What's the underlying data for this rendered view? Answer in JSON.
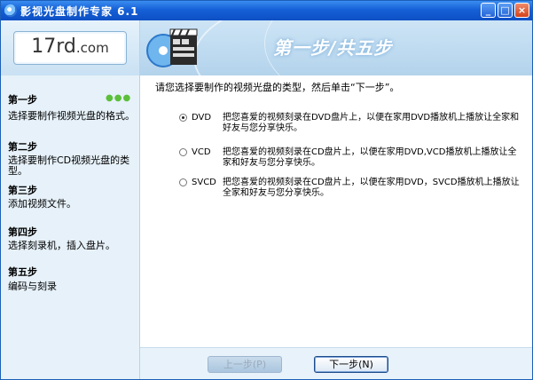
{
  "window": {
    "title": "影视光盘制作专家 6.1"
  },
  "controls": {
    "minimize": "_",
    "maximize": "□",
    "close": "×"
  },
  "logo": {
    "main": "17rd",
    "suffix": ".com"
  },
  "header": {
    "heading": "第一步/共五步"
  },
  "sidebar": {
    "current_indicator": "●●●",
    "steps": [
      {
        "title": "第一步",
        "desc": "选择要制作视频光盘的格式。"
      },
      {
        "title": "第二步",
        "desc": "选择要制作CD视频光盘的类型。"
      },
      {
        "title": "第三步",
        "desc": "添加视频文件。"
      },
      {
        "title": "第四步",
        "desc": "选择刻录机，插入盘片。"
      },
      {
        "title": "第五步",
        "desc": "编码与刻录"
      }
    ]
  },
  "content": {
    "prompt": "请您选择要制作的视频光盘的类型，然后单击“下一步”。",
    "options": [
      {
        "label": "DVD",
        "selected": true,
        "desc": "把您喜爱的视频刻录在DVD盘片上，以便在家用DVD播放机上播放让全家和好友与您分享快乐。"
      },
      {
        "label": "VCD",
        "selected": false,
        "desc": "把您喜爱的视频刻录在CD盘片上，以便在家用DVD,VCD播放机上播放让全家和好友与您分享快乐。"
      },
      {
        "label": "SVCD",
        "selected": false,
        "desc": "把您喜爱的视频刻录在CD盘片上，以便在家用DVD，SVCD播放机上播放让全家和好友与您分享快乐。"
      }
    ]
  },
  "buttons": {
    "prev": "上一步(P)",
    "next": "下一步(N)"
  }
}
